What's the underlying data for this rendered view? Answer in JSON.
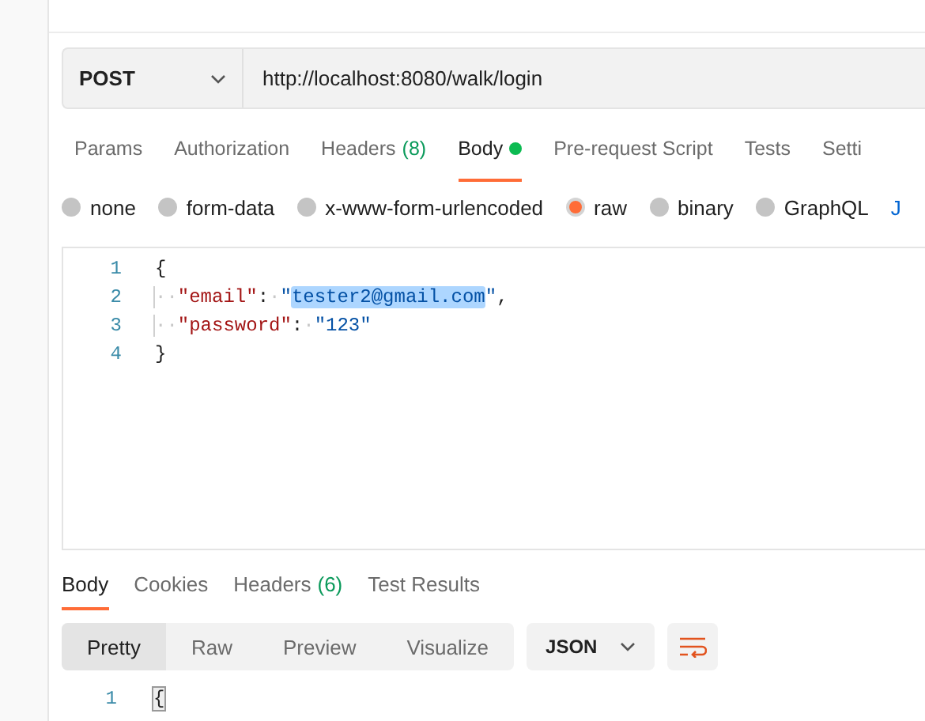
{
  "request": {
    "method": "POST",
    "url": "http://localhost:8080/walk/login"
  },
  "request_tabs": [
    {
      "label": "Params",
      "selected": false
    },
    {
      "label": "Authorization",
      "selected": false
    },
    {
      "label": "Headers",
      "count": "(8)",
      "selected": false
    },
    {
      "label": "Body",
      "dot": true,
      "selected": true
    },
    {
      "label": "Pre-request Script",
      "selected": false
    },
    {
      "label": "Tests",
      "selected": false
    },
    {
      "label": "Setti",
      "selected": false
    }
  ],
  "body_types": [
    {
      "label": "none",
      "selected": false
    },
    {
      "label": "form-data",
      "selected": false
    },
    {
      "label": "x-www-form-urlencoded",
      "selected": false
    },
    {
      "label": "raw",
      "selected": true
    },
    {
      "label": "binary",
      "selected": false
    },
    {
      "label": "GraphQL",
      "selected": false
    }
  ],
  "body_format": "J",
  "editor": {
    "lines": [
      {
        "number": "1",
        "tokens": [
          {
            "kind": "punct",
            "text": "{"
          }
        ]
      },
      {
        "number": "2",
        "tokens": [
          {
            "kind": "ws",
            "text": "··"
          },
          {
            "kind": "key",
            "text": "\"email\""
          },
          {
            "kind": "punct",
            "text": ":"
          },
          {
            "kind": "ws",
            "text": "·"
          },
          {
            "kind": "string",
            "text": "\""
          },
          {
            "kind": "string",
            "text": "tester2@gmail.com",
            "selected": true
          },
          {
            "kind": "string",
            "text": "\""
          },
          {
            "kind": "punct",
            "text": ","
          }
        ]
      },
      {
        "number": "3",
        "tokens": [
          {
            "kind": "ws",
            "text": "··"
          },
          {
            "kind": "key",
            "text": "\"password\""
          },
          {
            "kind": "punct",
            "text": ":"
          },
          {
            "kind": "ws",
            "text": "·"
          },
          {
            "kind": "string",
            "text": "\"123\""
          }
        ]
      },
      {
        "number": "4",
        "tokens": [
          {
            "kind": "punct",
            "text": "}"
          }
        ]
      }
    ]
  },
  "response_tabs": [
    {
      "label": "Body",
      "selected": true
    },
    {
      "label": "Cookies",
      "selected": false
    },
    {
      "label": "Headers",
      "count": "(6)",
      "selected": false
    },
    {
      "label": "Test Results",
      "selected": false
    }
  ],
  "view_modes": [
    {
      "label": "Pretty",
      "selected": true
    },
    {
      "label": "Raw",
      "selected": false
    },
    {
      "label": "Preview",
      "selected": false
    },
    {
      "label": "Visualize",
      "selected": false
    }
  ],
  "response_format": "JSON",
  "response_lines": [
    {
      "number": "1",
      "text": "{"
    }
  ]
}
